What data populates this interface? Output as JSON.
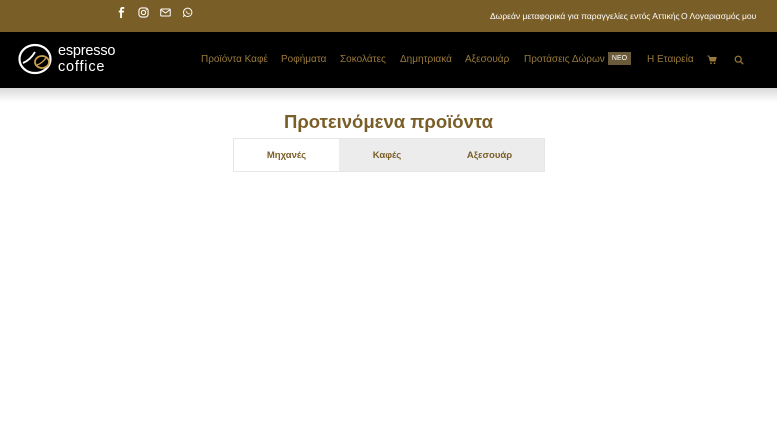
{
  "topbar": {
    "social_icons": [
      "facebook-icon",
      "instagram-icon",
      "mail-icon",
      "whatsapp-icon"
    ],
    "promo_text": "Δωρεάν μεταφορικά για παραγγελίες εντός Αττικής",
    "account_link": "Ο Λογαριασμός μου",
    "background": "#7a5e28"
  },
  "header": {
    "logo_line1": "espresso",
    "logo_line2": "coffice",
    "nav": [
      {
        "label": "Προϊόντα Καφέ"
      },
      {
        "label": "Ροφήματα"
      },
      {
        "label": "Σοκολάτες"
      },
      {
        "label": "Δημητριακά"
      },
      {
        "label": "Αξεσουάρ"
      },
      {
        "label": "Προτάσεις Δώρων",
        "badge": "ΝΕΟ"
      },
      {
        "label": "Η Εταιρεία"
      }
    ],
    "nav_color": "#9a7a3a"
  },
  "main": {
    "heading": "Προτεινόμενα προϊόντα",
    "tabs": [
      {
        "label": "Μηχανές",
        "active": true
      },
      {
        "label": "Καφές",
        "active": false
      },
      {
        "label": "Αξεσουάρ",
        "active": false
      }
    ]
  }
}
